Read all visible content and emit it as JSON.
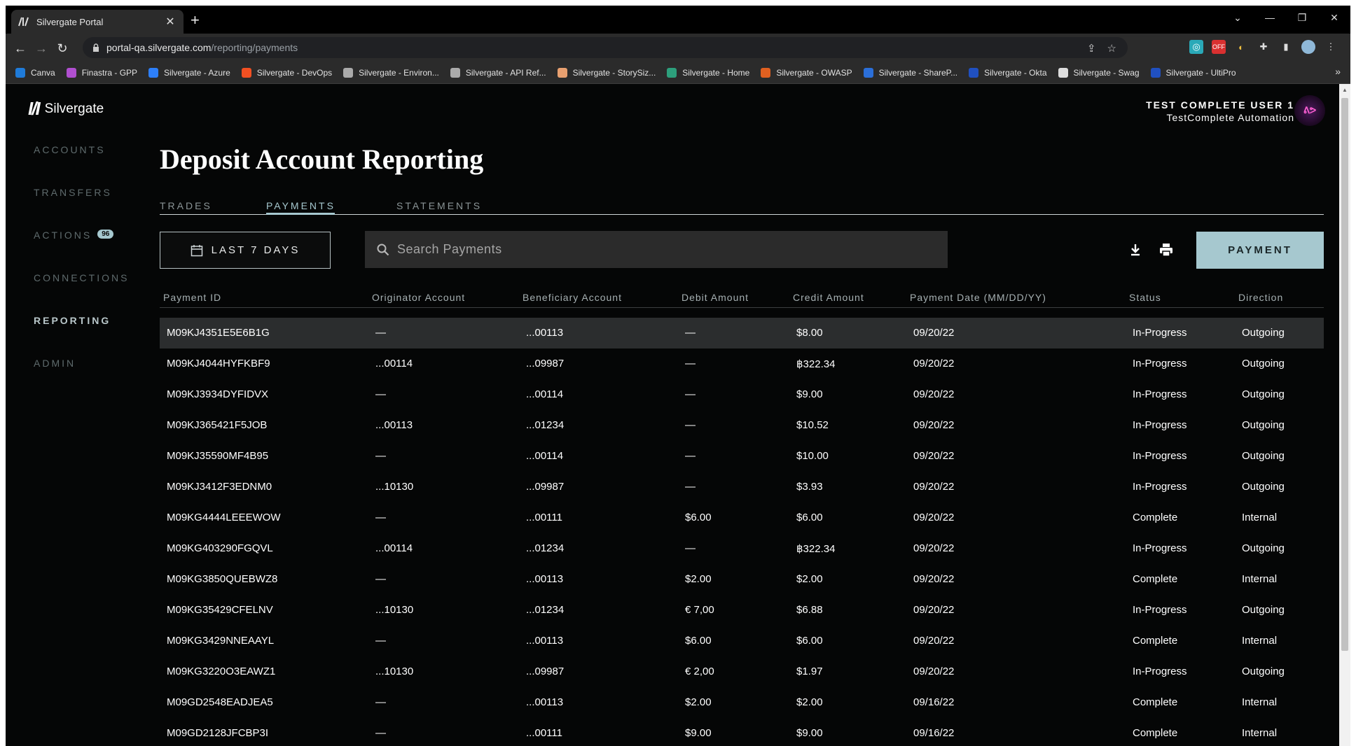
{
  "browser": {
    "tab_title": "Silvergate Portal",
    "url_host": "portal-qa.silvergate.com",
    "url_path": "/reporting/payments",
    "bookmarks": [
      {
        "label": "Canva",
        "color": "#1f7bd9"
      },
      {
        "label": "Finastra - GPP",
        "color": "#b04fd0"
      },
      {
        "label": "Silvergate - Azure",
        "color": "#2d7ff9"
      },
      {
        "label": "Silvergate - DevOps",
        "color": "#f25022"
      },
      {
        "label": "Silvergate - Environ...",
        "color": "#aaaaaa"
      },
      {
        "label": "Silvergate - API Ref...",
        "color": "#aaaaaa"
      },
      {
        "label": "Silvergate - StorySiz...",
        "color": "#e8a070"
      },
      {
        "label": "Silvergate - Home",
        "color": "#2d9f7c"
      },
      {
        "label": "Silvergate - OWASP",
        "color": "#e06020"
      },
      {
        "label": "Silvergate - ShareP...",
        "color": "#2b6fd9"
      },
      {
        "label": "Silvergate - Okta",
        "color": "#2050c0"
      },
      {
        "label": "Silvergate - Swag",
        "color": "#dddddd"
      },
      {
        "label": "Silvergate - UltiPro",
        "color": "#2050c0"
      }
    ]
  },
  "app": {
    "logo_text": "Silvergate",
    "user_name": "TEST COMPLETE USER 1",
    "user_org": "TestComplete Automation",
    "sidebar": [
      {
        "label": "ACCOUNTS",
        "active": false
      },
      {
        "label": "TRANSFERS",
        "active": false
      },
      {
        "label": "ACTIONS",
        "active": false,
        "badge": "96"
      },
      {
        "label": "CONNECTIONS",
        "active": false
      },
      {
        "label": "REPORTING",
        "active": true
      },
      {
        "label": "ADMIN",
        "active": false
      }
    ],
    "page_title": "Deposit Account Reporting",
    "tabs": [
      "TRADES",
      "PAYMENTS",
      "STATEMENTS"
    ],
    "active_tab": "PAYMENTS",
    "date_filter": "LAST 7 DAYS",
    "search_placeholder": "Search Payments",
    "payment_button": "PAYMENT",
    "accent_color": "#a6c8cf"
  },
  "table": {
    "columns": [
      "Payment ID",
      "Originator Account",
      "Beneficiary Account",
      "Debit Amount",
      "Credit Amount",
      "Payment Date (MM/DD/YY)",
      "Status",
      "Direction"
    ],
    "rows": [
      [
        "M09KJ4351E5E6B1G",
        "—",
        "...00113",
        "—",
        "$8.00",
        "09/20/22",
        "In-Progress",
        "Outgoing"
      ],
      [
        "M09KJ4044HYFKBF9",
        "...00114",
        "...09987",
        "—",
        "฿322.34",
        "09/20/22",
        "In-Progress",
        "Outgoing"
      ],
      [
        "M09KJ3934DYFIDVX",
        "—",
        "...00114",
        "—",
        "$9.00",
        "09/20/22",
        "In-Progress",
        "Outgoing"
      ],
      [
        "M09KJ365421F5JOB",
        "...00113",
        "...01234",
        "—",
        "$10.52",
        "09/20/22",
        "In-Progress",
        "Outgoing"
      ],
      [
        "M09KJ35590MF4B95",
        "—",
        "...00114",
        "—",
        "$10.00",
        "09/20/22",
        "In-Progress",
        "Outgoing"
      ],
      [
        "M09KJ3412F3EDNM0",
        "...10130",
        "...09987",
        "—",
        "$3.93",
        "09/20/22",
        "In-Progress",
        "Outgoing"
      ],
      [
        "M09KG4444LEEEWOW",
        "—",
        "...00111",
        "$6.00",
        "$6.00",
        "09/20/22",
        "Complete",
        "Internal"
      ],
      [
        "M09KG403290FGQVL",
        "...00114",
        "...01234",
        "—",
        "฿322.34",
        "09/20/22",
        "In-Progress",
        "Outgoing"
      ],
      [
        "M09KG3850QUEBWZ8",
        "—",
        "...00113",
        "$2.00",
        "$2.00",
        "09/20/22",
        "Complete",
        "Internal"
      ],
      [
        "M09KG35429CFELNV",
        "...10130",
        "...01234",
        "€ 7,00",
        "$6.88",
        "09/20/22",
        "In-Progress",
        "Outgoing"
      ],
      [
        "M09KG3429NNEAAYL",
        "—",
        "...00113",
        "$6.00",
        "$6.00",
        "09/20/22",
        "Complete",
        "Internal"
      ],
      [
        "M09KG3220O3EAWZ1",
        "...10130",
        "...09987",
        "€ 2,00",
        "$1.97",
        "09/20/22",
        "In-Progress",
        "Outgoing"
      ],
      [
        "M09GD2548EADJEA5",
        "—",
        "...00113",
        "$2.00",
        "$2.00",
        "09/16/22",
        "Complete",
        "Internal"
      ],
      [
        "M09GD2128JFCBP3I",
        "—",
        "...00111",
        "$9.00",
        "$9.00",
        "09/16/22",
        "Complete",
        "Internal"
      ]
    ]
  }
}
